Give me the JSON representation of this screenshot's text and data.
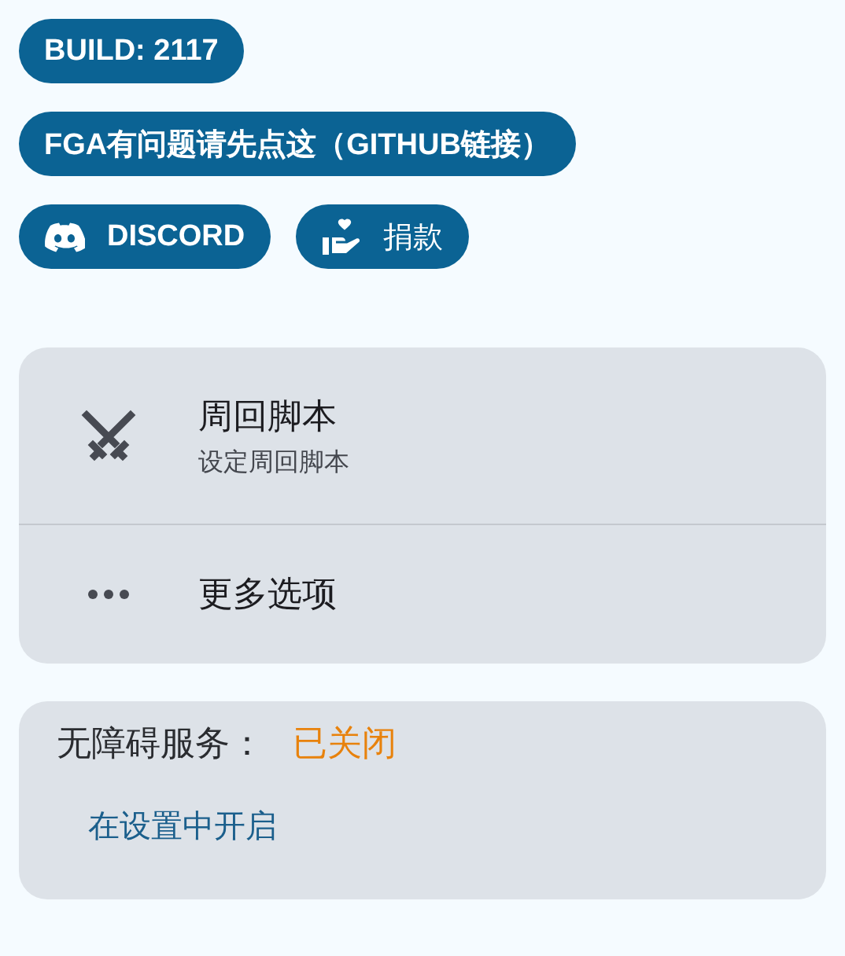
{
  "chips": [
    {
      "label": "BUILD: 2117"
    },
    {
      "label": "FGA有问题请先点这（GITHUB链接）"
    }
  ],
  "chip_row": [
    {
      "kind": "discord",
      "label": "DISCORD"
    },
    {
      "kind": "donate",
      "label": "捐款"
    }
  ],
  "menu": [
    {
      "kind": "swords",
      "title": "周回脚本",
      "subtitle": "设定周回脚本"
    },
    {
      "kind": "more",
      "title": "更多选项"
    }
  ],
  "accessibility": {
    "label": "无障碍服务：",
    "status": {
      "label": "已关闭",
      "color": "#e8820c"
    },
    "link": "在设置中开启"
  }
}
